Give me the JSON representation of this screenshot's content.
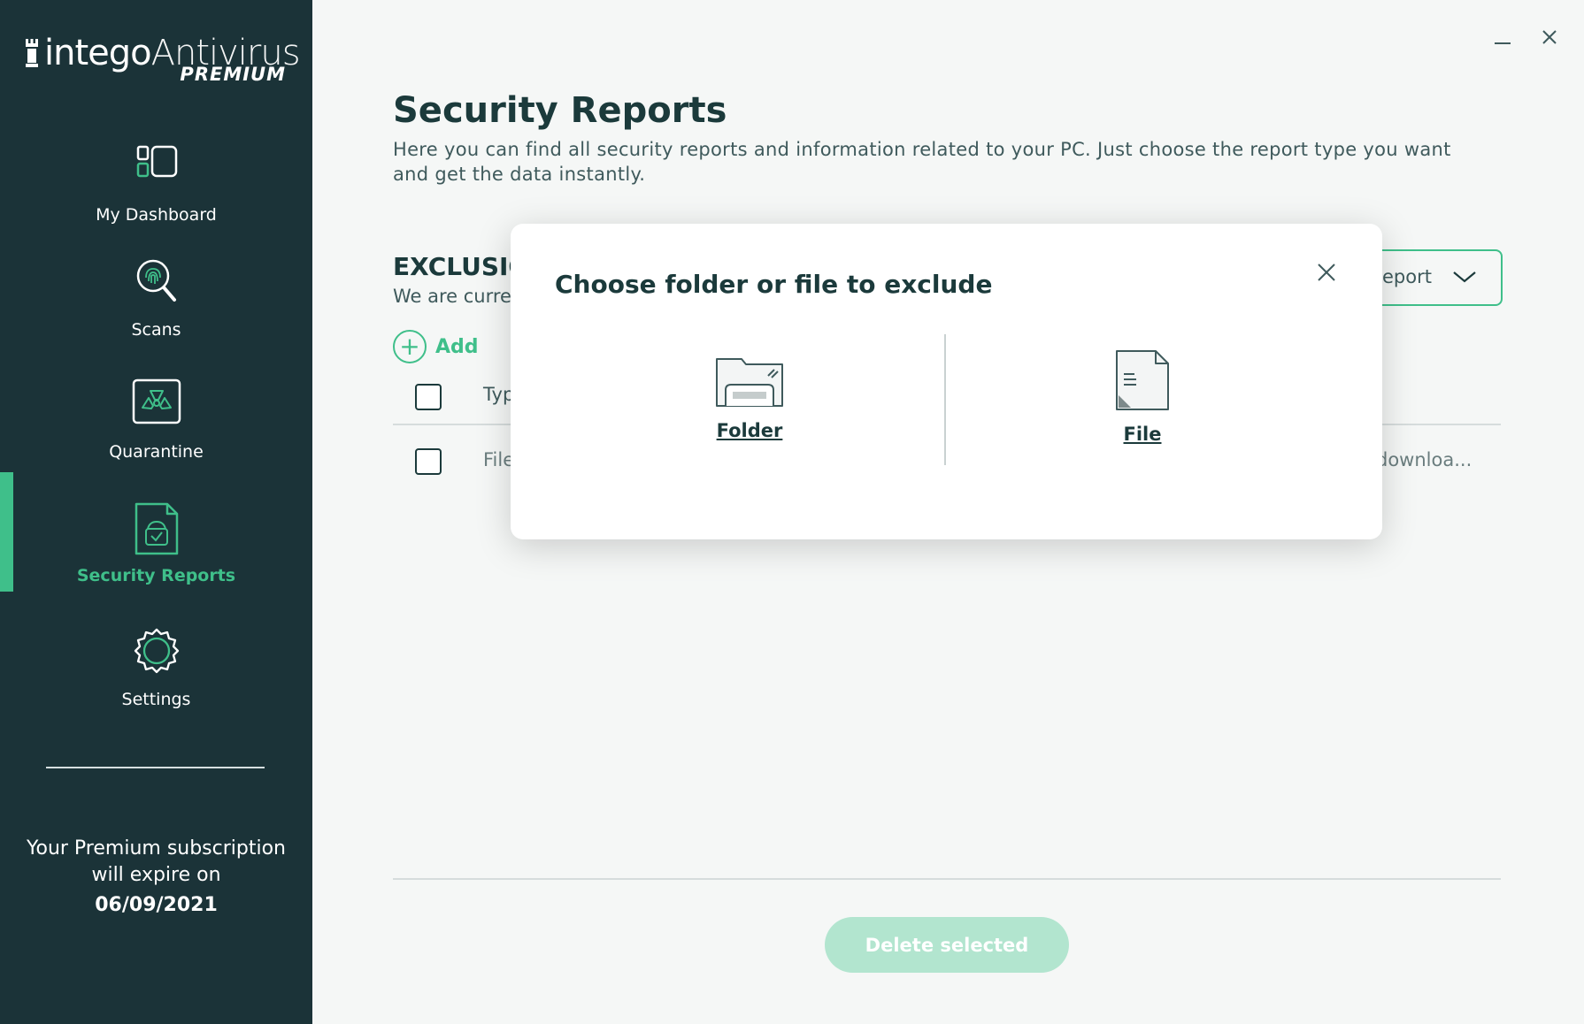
{
  "app": {
    "brand": "intego",
    "product": "Antivirus",
    "tier": "PREMIUM"
  },
  "sidebar": {
    "items": [
      {
        "label": "My Dashboard",
        "icon": "dashboard-icon"
      },
      {
        "label": "Scans",
        "icon": "fingerprint-scan-icon"
      },
      {
        "label": "Quarantine",
        "icon": "radiation-icon"
      },
      {
        "label": "Security Reports",
        "icon": "report-icon",
        "active": true
      },
      {
        "label": "Settings",
        "icon": "gear-icon"
      }
    ],
    "subscription": {
      "line1": "Your Premium subscription",
      "line2": "will expire on",
      "date": "06/09/2021"
    }
  },
  "main": {
    "title": "Security Reports",
    "description": "Here you can find all security reports and information related to your PC. Just choose the report type you want and get the data instantly.",
    "section_title": "EXCLUSIO",
    "section_subtitle": "We are curre",
    "add_label": "Add",
    "report_dropdown_label": "eport",
    "table": {
      "header_type": "Typ",
      "rows": [
        {
          "type": "File",
          "path": "downloa..."
        }
      ]
    },
    "delete_label": "Delete selected"
  },
  "modal": {
    "title": "Choose folder or file to exclude",
    "folder_label": "Folder",
    "file_label": "File"
  },
  "colors": {
    "sidebar_bg": "#1b3338",
    "accent": "#3fbf8a",
    "accent_light": "#b2e5cf",
    "text_dark": "#1b3a3b"
  }
}
